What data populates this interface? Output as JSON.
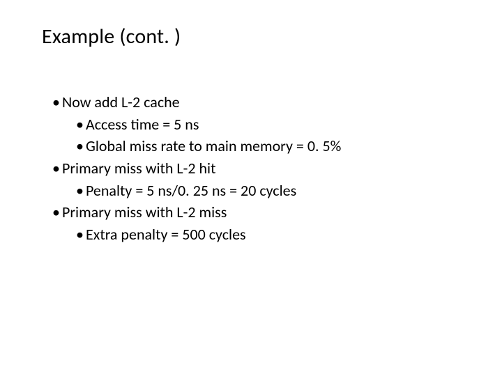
{
  "slide": {
    "title": "Example (cont. )",
    "bullets": {
      "b1": "Now add L-2 cache",
      "b1a": "Access time = 5 ns",
      "b1b": "Global miss rate to main memory = 0. 5%",
      "b2": "Primary miss with L-2 hit",
      "b2a": "Penalty = 5 ns/0. 25 ns = 20 cycles",
      "b3": "Primary miss with L-2 miss",
      "b3a": "Extra penalty = 500 cycles"
    }
  },
  "bullet_glyph": "•"
}
